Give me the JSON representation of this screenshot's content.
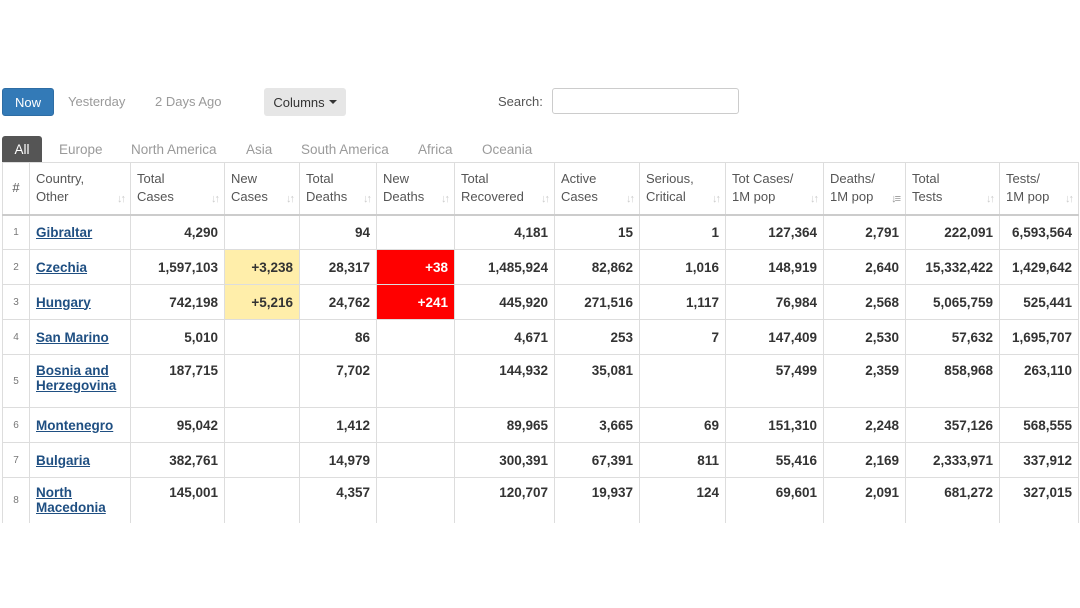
{
  "controls": {
    "now_label": "Now",
    "yesterday_label": "Yesterday",
    "two_days_label": "2 Days Ago",
    "columns_label": "Columns",
    "search_label": "Search:",
    "search_value": ""
  },
  "tabs": [
    "All",
    "Europe",
    "North America",
    "Asia",
    "South America",
    "Africa",
    "Oceania"
  ],
  "active_tab": "All",
  "colors": {
    "primary": "#337ab7",
    "new_cases_highlight": "#ffeeaa",
    "new_deaths_highlight": "#ff0000",
    "link": "#1f4f82"
  },
  "table": {
    "headers": [
      {
        "l1": "#",
        "l2": ""
      },
      {
        "l1": "Country,",
        "l2": "Other"
      },
      {
        "l1": "Total",
        "l2": "Cases"
      },
      {
        "l1": "New",
        "l2": "Cases"
      },
      {
        "l1": "Total",
        "l2": "Deaths"
      },
      {
        "l1": "New",
        "l2": "Deaths"
      },
      {
        "l1": "Total",
        "l2": "Recovered"
      },
      {
        "l1": "Active",
        "l2": "Cases"
      },
      {
        "l1": "Serious,",
        "l2": "Critical"
      },
      {
        "l1": "Tot Cases/",
        "l2": "1M pop"
      },
      {
        "l1": "Deaths/",
        "l2": "1M pop"
      },
      {
        "l1": "Total",
        "l2": "Tests"
      },
      {
        "l1": "Tests/",
        "l2": "1M pop"
      }
    ],
    "sorted_column": "Deaths/ 1M pop",
    "rows": [
      {
        "idx": "1",
        "country": "Gibraltar",
        "total_cases": "4,290",
        "new_cases": "",
        "total_deaths": "94",
        "new_deaths": "",
        "total_recovered": "4,181",
        "active_cases": "15",
        "serious": "1",
        "cases_per_1m": "127,364",
        "deaths_per_1m": "2,791",
        "total_tests": "222,091",
        "tests_per_1m": "6,593,564"
      },
      {
        "idx": "2",
        "country": "Czechia",
        "total_cases": "1,597,103",
        "new_cases": "+3,238",
        "total_deaths": "28,317",
        "new_deaths": "+38",
        "total_recovered": "1,485,924",
        "active_cases": "82,862",
        "serious": "1,016",
        "cases_per_1m": "148,919",
        "deaths_per_1m": "2,640",
        "total_tests": "15,332,422",
        "tests_per_1m": "1,429,642"
      },
      {
        "idx": "3",
        "country": "Hungary",
        "total_cases": "742,198",
        "new_cases": "+5,216",
        "total_deaths": "24,762",
        "new_deaths": "+241",
        "total_recovered": "445,920",
        "active_cases": "271,516",
        "serious": "1,117",
        "cases_per_1m": "76,984",
        "deaths_per_1m": "2,568",
        "total_tests": "5,065,759",
        "tests_per_1m": "525,441"
      },
      {
        "idx": "4",
        "country": "San Marino",
        "total_cases": "5,010",
        "new_cases": "",
        "total_deaths": "86",
        "new_deaths": "",
        "total_recovered": "4,671",
        "active_cases": "253",
        "serious": "7",
        "cases_per_1m": "147,409",
        "deaths_per_1m": "2,530",
        "total_tests": "57,632",
        "tests_per_1m": "1,695,707"
      },
      {
        "idx": "5",
        "country_l1": "Bosnia and",
        "country_l2": "Herzegovina",
        "total_cases": "187,715",
        "new_cases": "",
        "total_deaths": "7,702",
        "new_deaths": "",
        "total_recovered": "144,932",
        "active_cases": "35,081",
        "serious": "",
        "cases_per_1m": "57,499",
        "deaths_per_1m": "2,359",
        "total_tests": "858,968",
        "tests_per_1m": "263,110"
      },
      {
        "idx": "6",
        "country": "Montenegro",
        "total_cases": "95,042",
        "new_cases": "",
        "total_deaths": "1,412",
        "new_deaths": "",
        "total_recovered": "89,965",
        "active_cases": "3,665",
        "serious": "69",
        "cases_per_1m": "151,310",
        "deaths_per_1m": "2,248",
        "total_tests": "357,126",
        "tests_per_1m": "568,555"
      },
      {
        "idx": "7",
        "country": "Bulgaria",
        "total_cases": "382,761",
        "new_cases": "",
        "total_deaths": "14,979",
        "new_deaths": "",
        "total_recovered": "300,391",
        "active_cases": "67,391",
        "serious": "811",
        "cases_per_1m": "55,416",
        "deaths_per_1m": "2,169",
        "total_tests": "2,333,971",
        "tests_per_1m": "337,912"
      },
      {
        "idx": "8",
        "country_l1": "North",
        "country_l2": "Macedonia",
        "total_cases": "145,001",
        "new_cases": "",
        "total_deaths": "4,357",
        "new_deaths": "",
        "total_recovered": "120,707",
        "active_cases": "19,937",
        "serious": "124",
        "cases_per_1m": "69,601",
        "deaths_per_1m": "2,091",
        "total_tests": "681,272",
        "tests_per_1m": "327,015"
      }
    ]
  }
}
